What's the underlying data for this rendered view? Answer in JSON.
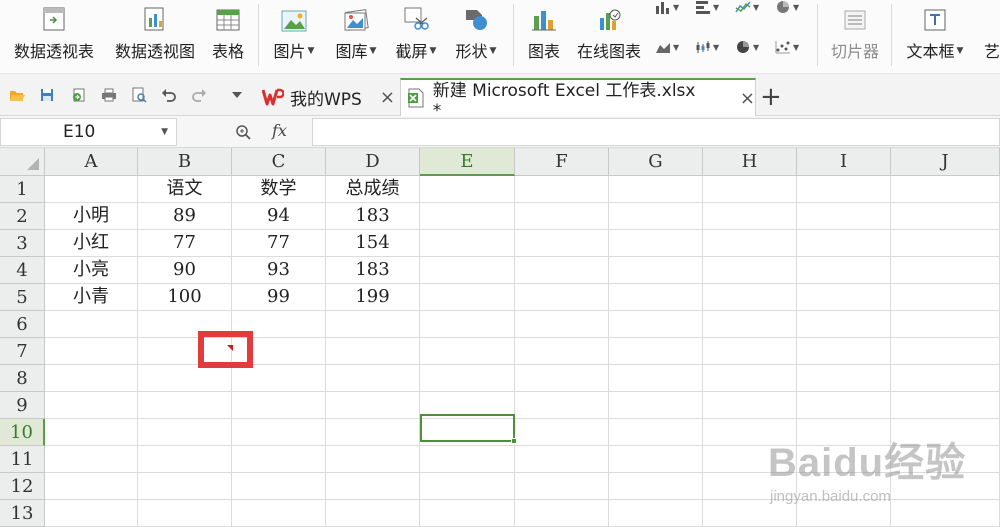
{
  "ribbon": {
    "buttons": [
      {
        "label": "数据透视表",
        "icon": "pivot-table-icon"
      },
      {
        "label": "数据透视图",
        "icon": "pivot-chart-icon"
      },
      {
        "label": "表格",
        "icon": "table-icon"
      },
      {
        "label": "图片",
        "icon": "picture-icon",
        "dropdown": true
      },
      {
        "label": "图库",
        "icon": "gallery-icon",
        "dropdown": true
      },
      {
        "label": "截屏",
        "icon": "screenshot-icon",
        "dropdown": true
      },
      {
        "label": "形状",
        "icon": "shapes-icon",
        "dropdown": true
      },
      {
        "label": "图表",
        "icon": "chart-icon"
      },
      {
        "label": "在线图表",
        "icon": "online-chart-icon"
      },
      {
        "label": "切片器",
        "icon": "slicer-icon",
        "disabled": true
      },
      {
        "label": "文本框",
        "icon": "textbox-icon",
        "dropdown": true
      },
      {
        "label": "艺",
        "icon": "art-text-icon"
      }
    ],
    "chart_type_icons": [
      "column-chart-icon",
      "bar-chart-icon",
      "line-chart-icon",
      "pie-chart-icon",
      "area-chart-icon",
      "stock-chart-icon",
      "donut-chart-icon",
      "scatter-chart-icon"
    ]
  },
  "quick_access": [
    "open-icon",
    "save-icon",
    "export-icon",
    "print-icon",
    "print-preview-icon",
    "undo-icon",
    "redo-icon",
    "more-icon"
  ],
  "tabs": [
    {
      "label": "我的WPS",
      "icon": "wps-logo-icon",
      "active": false
    },
    {
      "label": "新建 Microsoft Excel 工作表.xlsx *",
      "icon": "excel-file-icon",
      "active": true
    }
  ],
  "new_tab": "+",
  "formula_bar": {
    "name_box": "E10",
    "fx_label": "fx",
    "formula": ""
  },
  "sheet": {
    "columns": [
      "A",
      "B",
      "C",
      "D",
      "E",
      "F",
      "G",
      "H",
      "I",
      "J"
    ],
    "rows": [
      "1",
      "2",
      "3",
      "4",
      "5",
      "6",
      "7",
      "8",
      "9",
      "10",
      "11",
      "12",
      "13"
    ],
    "selected_column": "E",
    "selected_row": "10",
    "cells": [
      [
        "",
        "语文",
        "数学",
        "总成绩"
      ],
      [
        "小明",
        "89",
        "94",
        "183"
      ],
      [
        "小红",
        "77",
        "77",
        "154"
      ],
      [
        "小亮",
        "90",
        "93",
        "183"
      ],
      [
        "小青",
        "100",
        "99",
        "199"
      ]
    ]
  },
  "watermark": {
    "logo": "Baidu经验",
    "url": "jingyan.baidu.com"
  }
}
